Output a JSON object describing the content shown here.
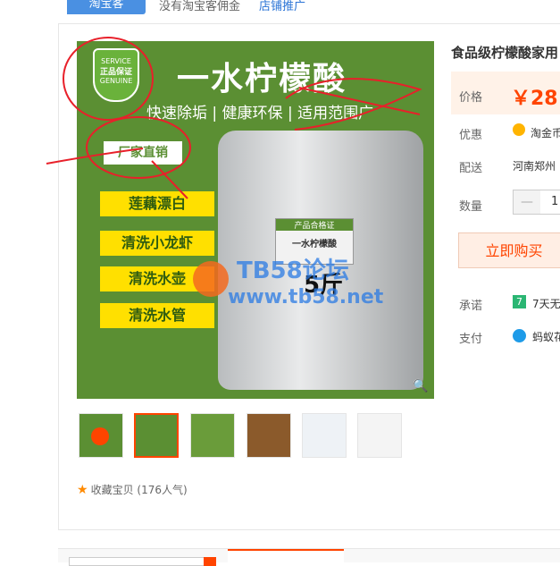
{
  "topbar": {
    "tag": "淘宝客",
    "text": "没有淘宝客佣金",
    "link": "店铺推广"
  },
  "product_image": {
    "title": "一水柠檬酸",
    "subtitle": "快速除垢 | 健康环保 | 适用范围广",
    "badge_line1": "SERVICE",
    "badge_line2": "正品保证",
    "badge_line3": "GENUINE",
    "ribbon": "厂家直销",
    "uses": [
      "莲藕漂白",
      "清洗小龙虾",
      "清洗水壶",
      "清洗水管"
    ],
    "bag_label": "产品合格证",
    "bag_name": "一水柠檬酸",
    "bag_weight": "5斤",
    "watermark1": "TB58论坛",
    "watermark2": "www.tb58.net"
  },
  "favorite": {
    "label": "收藏宝贝",
    "count": "(176人气)"
  },
  "product": {
    "title": "食品级柠檬酸家用",
    "price_label": "价格",
    "price": "￥28",
    "discount_label": "优惠",
    "discount_value": "淘金币",
    "ship_label": "配送",
    "ship_value": "河南郑州",
    "qty_label": "数量",
    "qty_value": "1",
    "buy_label": "立即购买",
    "promise_label": "承诺",
    "promise_value": "7天无",
    "pay_label": "支付",
    "pay_value": "蚂蚁花"
  },
  "colors": {
    "brand": "#ff4400",
    "green": "#5b8f33",
    "yellow": "#ffe000"
  }
}
